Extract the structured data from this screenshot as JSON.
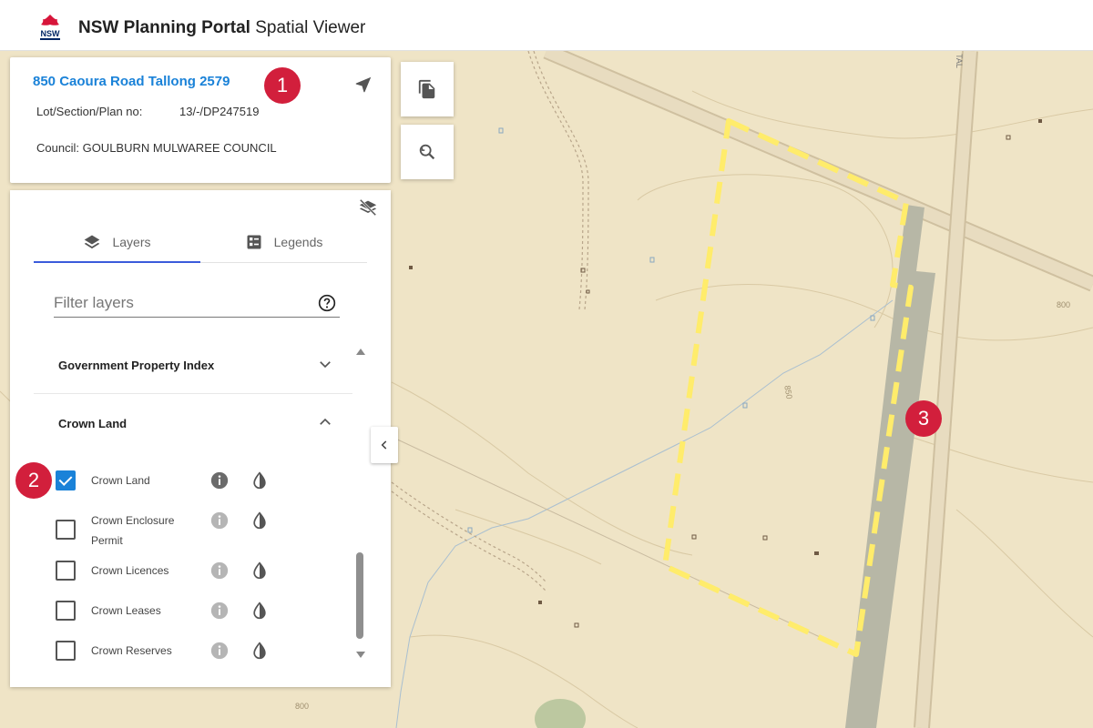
{
  "header": {
    "logo_text": "NSW",
    "title_bold": "NSW Planning Portal",
    "title_rest": "Spatial Viewer"
  },
  "property": {
    "address": "850 Caoura Road Tallong 2579",
    "lot_label": "Lot/Section/Plan no:",
    "lot_value": "13/-/DP247519",
    "council": "Council: GOULBURN MULWAREE COUNCIL"
  },
  "tabs": {
    "layers": "Layers",
    "legends": "Legends"
  },
  "filter": {
    "placeholder": "Filter layers"
  },
  "groups": {
    "gpi": "Government Property Index",
    "crown_land": "Crown Land"
  },
  "layers": [
    {
      "label": "Crown Land",
      "checked": true
    },
    {
      "label": "Crown Enclosure Permit",
      "checked": false
    },
    {
      "label": "Crown Licences",
      "checked": false
    },
    {
      "label": "Crown Leases",
      "checked": false
    },
    {
      "label": "Crown Reserves",
      "checked": false
    }
  ],
  "callouts": [
    "1",
    "2",
    "3"
  ],
  "map": {
    "contour_labels": [
      "800",
      "850",
      "800"
    ],
    "road_label": "TAL",
    "colors": {
      "background": "#efe4c6",
      "boundary": "#ffec6b",
      "crown_land": "#b7b7a6",
      "accent": "#1a82d8",
      "badge": "#d21f3c"
    }
  }
}
